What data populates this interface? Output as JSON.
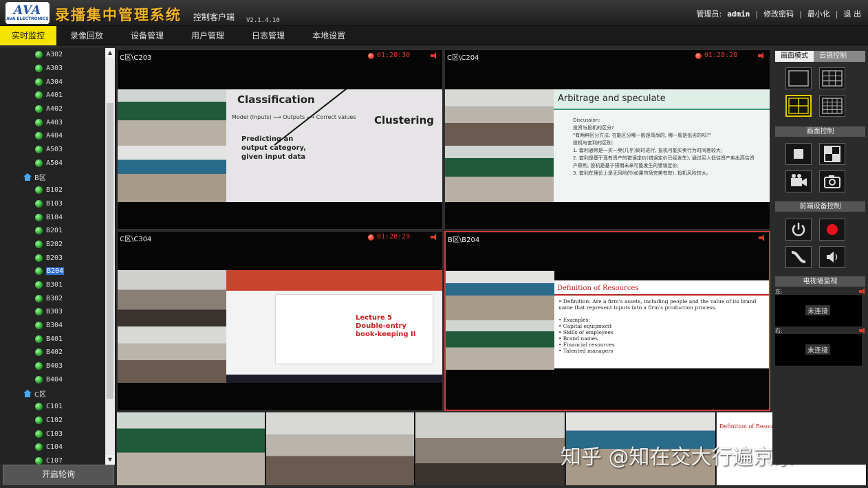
{
  "header": {
    "logo_mark": "AVA",
    "logo_sub": "AVA ELECTRONICS",
    "title": "录播集中管理系统",
    "subtitle": "控制客户端",
    "version": "V2.1.4.10",
    "admin_label": "管理员:",
    "admin_user": "admin",
    "change_password": "修改密码",
    "minimize": "最小化",
    "exit": "退 出",
    "separator": "|"
  },
  "menu": {
    "items": [
      "实时监控",
      "录像回放",
      "设备管理",
      "用户管理",
      "日志管理",
      "本地设置"
    ]
  },
  "tree": {
    "rows": [
      {
        "type": "room",
        "label": "A302"
      },
      {
        "type": "room",
        "label": "A303"
      },
      {
        "type": "room",
        "label": "A304"
      },
      {
        "type": "room",
        "label": "A401"
      },
      {
        "type": "room",
        "label": "A402"
      },
      {
        "type": "room",
        "label": "A403"
      },
      {
        "type": "room",
        "label": "A404"
      },
      {
        "type": "room",
        "label": "A503"
      },
      {
        "type": "room",
        "label": "A504"
      },
      {
        "type": "zone",
        "label": "B区"
      },
      {
        "type": "room",
        "label": "B102"
      },
      {
        "type": "room",
        "label": "B103"
      },
      {
        "type": "room",
        "label": "B104"
      },
      {
        "type": "room",
        "label": "B201"
      },
      {
        "type": "room",
        "label": "B202"
      },
      {
        "type": "room",
        "label": "B203"
      },
      {
        "type": "room",
        "label": "B204",
        "selected": true
      },
      {
        "type": "room",
        "label": "B301"
      },
      {
        "type": "room",
        "label": "B302"
      },
      {
        "type": "room",
        "label": "B303"
      },
      {
        "type": "room",
        "label": "B304"
      },
      {
        "type": "room",
        "label": "B401"
      },
      {
        "type": "room",
        "label": "B402"
      },
      {
        "type": "room",
        "label": "B403"
      },
      {
        "type": "room",
        "label": "B404"
      },
      {
        "type": "zone",
        "label": "C区"
      },
      {
        "type": "room",
        "label": "C101"
      },
      {
        "type": "room",
        "label": "C102"
      },
      {
        "type": "room",
        "label": "C103"
      },
      {
        "type": "room",
        "label": "C104"
      },
      {
        "type": "room",
        "label": "C107"
      }
    ],
    "tour_button": "开启轮询"
  },
  "cells": [
    {
      "title": "C区\\C203",
      "time": "01:28:30",
      "recording": true
    },
    {
      "title": "C区\\C204",
      "time": "01:28:28",
      "recording": true
    },
    {
      "title": "C区\\C304",
      "time": "01:28:29",
      "recording": true
    },
    {
      "title": "B区\\B204",
      "time": "",
      "recording": false
    }
  ],
  "slides": {
    "s1": {
      "title": "Classification",
      "line1": "Model (Inputs) ⟶ Outputs ⟶ Correct values",
      "line2": "Predicting an output category, given input data",
      "title2": "Clustering"
    },
    "s2": {
      "title": "Arbitrage and speculate",
      "body": "Discussion:\n投资与投机的区分?\n\"有两种区分方法: 在能区分哪一般是高尚的, 哪一般是低劣的吗?\"\n投机与套利的区别:\n1. 套利通常是一买一卖(几乎)同时进行, 投机可能买卖行为时间差较大;\n2. 套利是基于现有资产的错误定价(错误定价已经发生), 通过买入低估资产卖出高估资产获利, 投机是基于预期未来可能发生的错误定价;\n3. 套利在理论上是无风险的(如果市场完美有效), 投机风险较大。",
      "red_line": "投机与套利的区别:"
    },
    "s3": {
      "title": "Lecture 5\nDouble-entry\nbook-keeping II"
    },
    "s4": {
      "title": "Definition of Resources",
      "body": "• Definition: Are a firm's assets, including people and the value of its brand name that represent inputs into a firm's production process.\n\n• Examples:\n   • Capital equipment\n   • Skills of employees\n   • Brand names\n   • Financial resources\n   • Talented managers"
    }
  },
  "right_panel": {
    "tabs": [
      "画面模式",
      "云镜控制"
    ],
    "section_screen": "画面控制",
    "section_device": "前端设备控制",
    "section_tv": "电视墙监视",
    "tv_left_label": "左:",
    "tv_right_label": "右:",
    "tv_left_status": "未连接",
    "tv_right_status": "未连接"
  },
  "watermark": "知乎 @知在交大行遍京冢",
  "colors": {
    "accent": "#f5e400",
    "record": "#e23a2a",
    "online": "#2a9d2a",
    "selected_border": "#d43a3a"
  }
}
